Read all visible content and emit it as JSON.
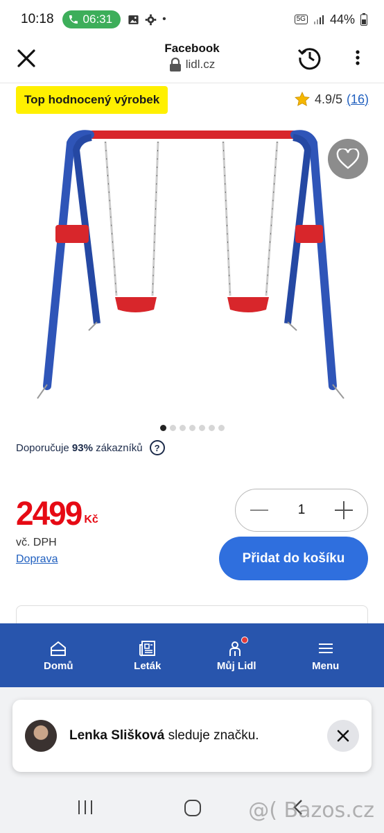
{
  "status_bar": {
    "time": "10:18",
    "call_timer": "06:31",
    "network": "5G",
    "battery": "44%"
  },
  "browser": {
    "title": "Facebook",
    "url": "lidl.cz"
  },
  "product": {
    "badge": "Top hodnocený výrobek",
    "rating": "4.9/5",
    "rating_count": "(16)",
    "image_count": 7,
    "active_image_index": 0,
    "recommend_prefix": "Doporučuje",
    "recommend_percent": "93%",
    "recommend_suffix": "zákazníků",
    "help": "?",
    "price": "2499",
    "currency": "Kč",
    "vat_note": "vč. DPH",
    "shipping_link": "Doprava",
    "quantity": "1",
    "add_to_cart": "Přidat do košíku"
  },
  "bottom_nav": {
    "items": [
      {
        "label": "Domů",
        "icon": "home-icon"
      },
      {
        "label": "Leták",
        "icon": "newspaper-icon"
      },
      {
        "label": "Můj Lidl",
        "icon": "user-icon"
      },
      {
        "label": "Menu",
        "icon": "hamburger-icon"
      }
    ]
  },
  "toast": {
    "name": "Lenka Slišková",
    "message": "sleduje značku."
  },
  "watermark": "@( Bazos.cz",
  "colors": {
    "accent_blue": "#2f6fde",
    "nav_blue": "#2855ad",
    "price_red": "#e60a14",
    "badge_yellow": "#fff000",
    "call_green": "#3dae5a"
  }
}
